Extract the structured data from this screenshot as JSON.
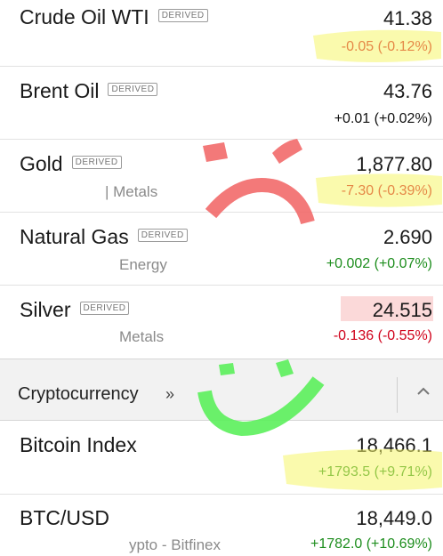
{
  "rows": [
    {
      "name": "Crude Oil WTI",
      "badge": "DERIVED",
      "sub": "",
      "price": "41.38",
      "change": "-0.05 (-0.12%)",
      "direction": "negative"
    },
    {
      "name": "Brent Oil",
      "badge": "DERIVED",
      "sub": "",
      "price": "43.76",
      "change": "+0.01 (+0.02%)",
      "direction": "neutral"
    },
    {
      "name": "Gold",
      "badge": "DERIVED",
      "sub": "| Metals",
      "price": "1,877.80",
      "change": "-7.30 (-0.39%)",
      "direction": "negative"
    },
    {
      "name": "Natural Gas",
      "badge": "DERIVED",
      "sub": "Energy",
      "price": "2.690",
      "change": "+0.002 (+0.07%)",
      "direction": "positive"
    },
    {
      "name": "Silver",
      "badge": "DERIVED",
      "sub": "Metals",
      "price": "24.515",
      "change": "-0.136 (-0.55%)",
      "direction": "negative"
    }
  ],
  "section": {
    "title": "Cryptocurrency",
    "arrow": "»",
    "collapse_icon": "chevron-up-icon"
  },
  "crypto_rows": [
    {
      "name": "Bitcoin Index",
      "sub": "",
      "price": "18,466.1",
      "change": "+1793.5 (+9.71%)",
      "direction": "positive"
    },
    {
      "name": "BTC/USD",
      "sub": "ypto - Bitfinex",
      "price": "18,449.0",
      "change": "+1782.0 (+10.69%)",
      "direction": "positive"
    }
  ],
  "colors": {
    "negative": "#d0021b",
    "positive": "#1e8e1e",
    "highlight_yellow": "#f5f56a",
    "sad_face_red": "#f26a6a",
    "happy_face_green": "#5bf05b",
    "price_flash": "#fbd9d9"
  }
}
